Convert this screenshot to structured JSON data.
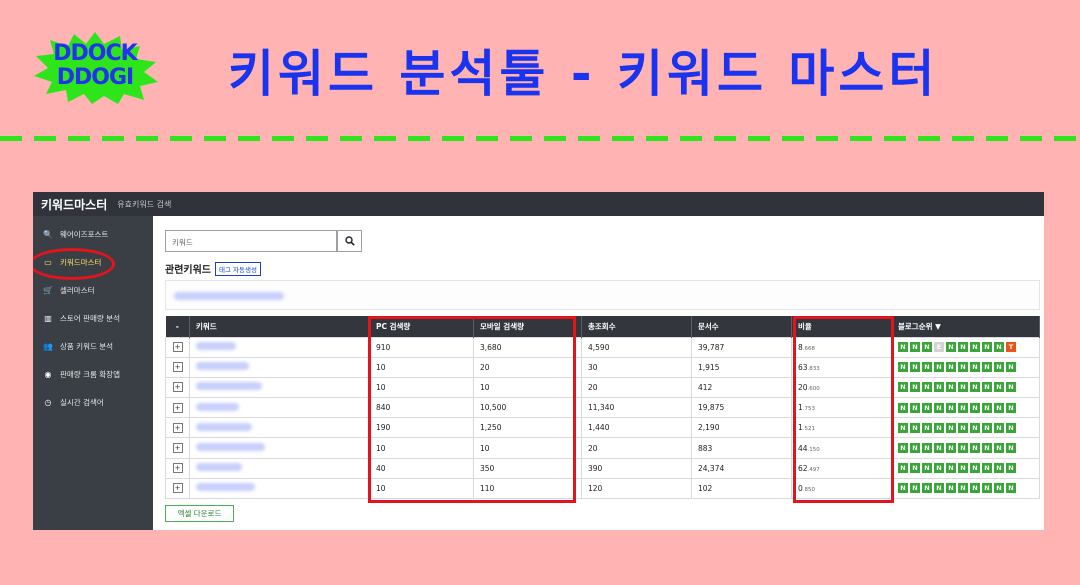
{
  "banner": {
    "logo_line1": "DDOCK",
    "logo_line2": "DDOGI",
    "title": "키워드 분석툴 - 키워드 마스터"
  },
  "app": {
    "title": "키워드마스터",
    "subtitle": "유효키워드 검색"
  },
  "sidebar": {
    "items": [
      {
        "icon": "search-icon",
        "glyph": "🔍",
        "label": "웨어이즈포스트"
      },
      {
        "icon": "card-icon",
        "glyph": "▭",
        "label": "키워드마스터",
        "active": true
      },
      {
        "icon": "cart-icon",
        "glyph": "🛒",
        "label": "셀러마스터"
      },
      {
        "icon": "bar-chart-icon",
        "glyph": "▥",
        "label": "스토어 판매량 분석"
      },
      {
        "icon": "users-icon",
        "glyph": "👥",
        "label": "상품 키워드 분석"
      },
      {
        "icon": "chrome-icon",
        "glyph": "◉",
        "label": "판매량 크롬 확장앱"
      },
      {
        "icon": "clock-icon",
        "glyph": "◷",
        "label": "실시간 검색어"
      }
    ]
  },
  "search": {
    "placeholder": "키워드",
    "button_icon": "search-icon"
  },
  "related": {
    "title": "관련키워드",
    "tag_button": "태그 자동생성"
  },
  "table": {
    "headers": [
      "-",
      "키워드",
      "PC 검색량",
      "모바일 검색량",
      "총조회수",
      "문서수",
      "비율",
      "블로그순위 ▼"
    ],
    "rows": [
      {
        "pc": "910",
        "mobile": "3,680",
        "total": "4,590",
        "docs": "39,787",
        "ratio_main": "8",
        "ratio_sub": ".668",
        "badges": [
          "N",
          "N",
          "N",
          "E",
          "N",
          "N",
          "N",
          "N",
          "N",
          "T"
        ]
      },
      {
        "pc": "10",
        "mobile": "20",
        "total": "30",
        "docs": "1,915",
        "ratio_main": "63",
        "ratio_sub": ".833",
        "badges": [
          "N",
          "N",
          "N",
          "N",
          "N",
          "N",
          "N",
          "N",
          "N",
          "N"
        ]
      },
      {
        "pc": "10",
        "mobile": "10",
        "total": "20",
        "docs": "412",
        "ratio_main": "20",
        "ratio_sub": ".600",
        "badges": [
          "N",
          "N",
          "N",
          "N",
          "N",
          "N",
          "N",
          "N",
          "N",
          "N"
        ]
      },
      {
        "pc": "840",
        "mobile": "10,500",
        "total": "11,340",
        "docs": "19,875",
        "ratio_main": "1",
        "ratio_sub": ".753",
        "badges": [
          "N",
          "N",
          "N",
          "N",
          "N",
          "N",
          "N",
          "N",
          "N",
          "N"
        ]
      },
      {
        "pc": "190",
        "mobile": "1,250",
        "total": "1,440",
        "docs": "2,190",
        "ratio_main": "1",
        "ratio_sub": ".521",
        "badges": [
          "N",
          "N",
          "N",
          "N",
          "N",
          "N",
          "N",
          "N",
          "N",
          "N"
        ]
      },
      {
        "pc": "10",
        "mobile": "10",
        "total": "20",
        "docs": "883",
        "ratio_main": "44",
        "ratio_sub": ".150",
        "badges": [
          "N",
          "N",
          "N",
          "N",
          "N",
          "N",
          "N",
          "N",
          "N",
          "N"
        ]
      },
      {
        "pc": "40",
        "mobile": "350",
        "total": "390",
        "docs": "24,374",
        "ratio_main": "62",
        "ratio_sub": ".497",
        "badges": [
          "N",
          "N",
          "N",
          "N",
          "N",
          "N",
          "N",
          "N",
          "N",
          "N"
        ]
      },
      {
        "pc": "10",
        "mobile": "110",
        "total": "120",
        "docs": "102",
        "ratio_main": "0",
        "ratio_sub": ".850",
        "badges": [
          "N",
          "N",
          "N",
          "N",
          "N",
          "N",
          "N",
          "N",
          "N",
          "N"
        ]
      }
    ],
    "expand_glyph": "+"
  },
  "excel_button": "엑셀 다운로드",
  "colors": {
    "background": "#ffb3b3",
    "accent_blue": "#1a33ee",
    "dash_green": "#2ee51c",
    "highlight_red": "#e3141b",
    "badge_green": "#3aa63a",
    "badge_orange": "#e8561b",
    "dark": "#33373d"
  }
}
